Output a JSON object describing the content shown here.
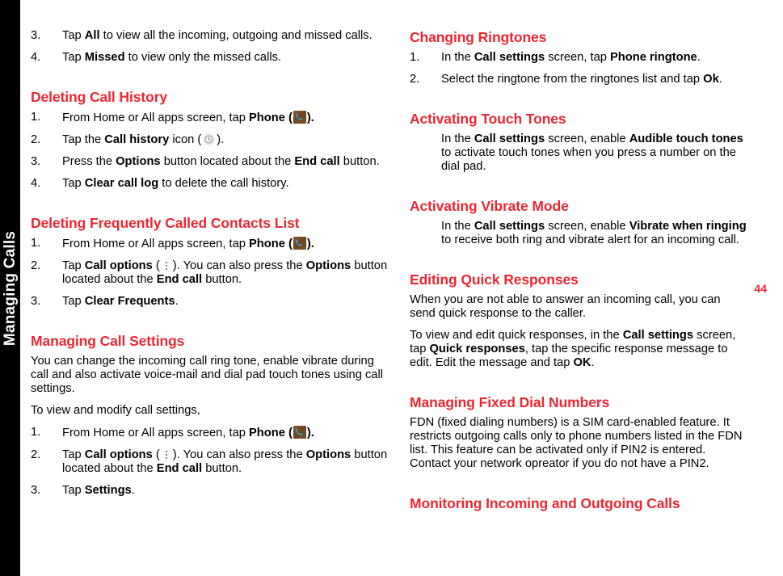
{
  "chapter_tab": {
    "label": "Managing Calls"
  },
  "page_number": "44",
  "colors": {
    "heading_red": "#ED2733",
    "tab_background": "#000000",
    "body_text": "#000000"
  },
  "icons": {
    "phone": "phone-app-icon",
    "call_history": "clock-icon",
    "call_options": "kebab-menu-icon"
  },
  "left_column": {
    "step_3_all": {
      "num": "3.",
      "pre": "Tap ",
      "b1": "All",
      "post": " to view all the incoming, outgoing and missed calls."
    },
    "step_4_missed": {
      "num": "4.",
      "pre": "Tap ",
      "b1": "Missed",
      "post": " to view only the missed calls."
    },
    "h_deleting_call_history": "Deleting Call History",
    "dch_1": {
      "num": "1.",
      "pre": "From Home or All apps screen, tap ",
      "b1": "Phone",
      "mid": " (",
      "post": ")."
    },
    "dch_2": {
      "num": "2.",
      "pre": "Tap the ",
      "b1": "Call history",
      "mid": " icon (",
      "post": ")."
    },
    "dch_3": {
      "num": "3.",
      "pre": "Press the ",
      "b1": "Options",
      "mid": " button located about the ",
      "b2": "End call",
      "post": " button."
    },
    "dch_4": {
      "num": "4.",
      "pre": "Tap ",
      "b1": "Clear call log",
      "post": " to delete the call history."
    },
    "h_deleting_frequently": "Deleting Frequently Called Contacts List",
    "dfc_1": {
      "num": "1.",
      "pre": "From Home or All apps screen, tap ",
      "b1": "Phone",
      "mid": " (",
      "post": ")."
    },
    "dfc_2": {
      "num": "2.",
      "pre": "Tap ",
      "b1": "Call options",
      "mid": " (",
      "mid2": "). You can also press the ",
      "b2": "Options",
      "mid3": " button located about the ",
      "b3": "End call",
      "post": " button."
    },
    "dfc_3": {
      "num": "3.",
      "pre": "Tap ",
      "b1": "Clear Frequents",
      "post": "."
    },
    "h_managing_call_settings": "Managing Call Settings",
    "mcs_para1": "You can change the incoming call ring tone, enable vibrate during call and also activate voice-mail and dial pad touch tones using call settings.",
    "mcs_para2": "To view and modify call settings,",
    "mcs_1": {
      "num": "1.",
      "pre": "From Home or All apps screen, tap ",
      "b1": "Phone",
      "mid": " (",
      "post": ")."
    },
    "mcs_2": {
      "num": "2.",
      "pre": "Tap ",
      "b1": "Call options",
      "mid": " (",
      "mid2": "). You can also press the ",
      "b2": "Options",
      "mid3": " button located about the ",
      "b3": "End call",
      "post": " button."
    },
    "mcs_3": {
      "num": "3.",
      "pre": "Tap ",
      "b1": "Settings",
      "post": "."
    }
  },
  "right_column": {
    "h_changing_ringtones": "Changing Ringtones",
    "cr_1": {
      "num": "1.",
      "pre": "In the ",
      "b1": "Call settings",
      "mid": " screen, tap ",
      "b2": "Phone ringtone",
      "post": "."
    },
    "cr_2": {
      "num": "2.",
      "pre": "Select the ringtone from the ringtones list and tap ",
      "b1": "Ok",
      "post": "."
    },
    "h_activating_touch_tones": "Activating Touch Tones",
    "att_para": {
      "pre": "In the ",
      "b1": "Call settings",
      "mid": " screen, enable ",
      "b2": "Audible touch tones",
      "post": " to activate touch tones when you press a number on the dial pad."
    },
    "h_activating_vibrate_mode": "Activating Vibrate Mode",
    "avm_para": {
      "pre": "In the ",
      "b1": "Call settings",
      "mid": " screen, enable ",
      "b2": "Vibrate when ringing",
      "post": " to receive both ring and vibrate alert for an incoming call."
    },
    "h_editing_quick_responses": "Editing Quick Responses",
    "eqr_para1": "When you are not able to answer an incoming call, you can send quick response to the caller.",
    "eqr_para2": {
      "pre": "To view and edit quick responses, in the ",
      "b1": "Call settings",
      "mid": " screen, tap ",
      "b2": "Quick responses",
      "mid2": ", tap the specific response message to edit. Edit the message and tap ",
      "b3": "OK",
      "post": "."
    },
    "h_managing_fixed_dial": "Managing Fixed Dial Numbers",
    "mfd_para": "FDN (fixed dialing numbers) is a SIM card-enabled feature. It restricts outgoing calls only to phone numbers listed in the FDN list. This feature can be activated only if PIN2 is entered. Contact your network opreator if you do not have a PIN2.",
    "h_monitoring_calls": "Monitoring Incoming and Outgoing Calls"
  }
}
